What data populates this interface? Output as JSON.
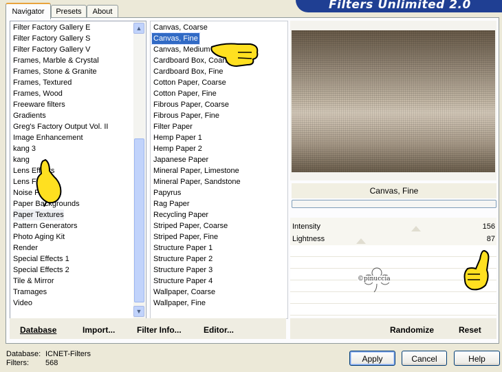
{
  "tabs": [
    {
      "label": "Navigator",
      "active": true
    },
    {
      "label": "Presets",
      "active": false
    },
    {
      "label": "About",
      "active": false
    }
  ],
  "banner": {
    "title": "Filters Unlimited 2.0"
  },
  "categories": [
    "Filter Factory Gallery E",
    "Filter Factory Gallery S",
    "Filter Factory Gallery V",
    "Frames, Marble & Crystal",
    "Frames, Stone & Granite",
    "Frames, Textured",
    "Frames, Wood",
    "Freeware filters",
    "Gradients",
    "Greg's Factory Output Vol. II",
    "Image Enhancement",
    "kang 3",
    "kang",
    "Lens Effects",
    "Lens Flares",
    "Noise Filters",
    "Paper Backgrounds",
    "Paper Textures",
    "Pattern Generators",
    "Photo Aging Kit",
    "Render",
    "Special Effects 1",
    "Special Effects 2",
    "Tile & Mirror",
    "Tramages",
    "Video"
  ],
  "selected_category": "Paper Textures",
  "filters": [
    "Canvas, Coarse",
    "Canvas, Fine",
    "Canvas, Medium",
    "Cardboard Box, Coarse",
    "Cardboard Box, Fine",
    "Cotton Paper, Coarse",
    "Cotton Paper, Fine",
    "Fibrous Paper, Coarse",
    "Fibrous Paper, Fine",
    "Filter Paper",
    "Hemp Paper 1",
    "Hemp Paper 2",
    "Japanese Paper",
    "Mineral Paper, Limestone",
    "Mineral Paper, Sandstone",
    "Papyrus",
    "Rag Paper",
    "Recycling Paper",
    "Striped Paper, Coarse",
    "Striped Paper, Fine",
    "Structure Paper 1",
    "Structure Paper 2",
    "Structure Paper 3",
    "Structure Paper 4",
    "Wallpaper, Coarse",
    "Wallpaper, Fine"
  ],
  "selected_filter": "Canvas, Fine",
  "left_buttons": {
    "database": "Database",
    "import": "Import...",
    "filter_info": "Filter Info...",
    "editor": "Editor..."
  },
  "preview": {
    "filter_name": "Canvas, Fine",
    "progress": 0
  },
  "params": [
    {
      "label": "Intensity",
      "value": "156"
    },
    {
      "label": "Lightness",
      "value": "87"
    }
  ],
  "watermark": "©pinuccia",
  "right_buttons": {
    "randomize": "Randomize",
    "reset": "Reset"
  },
  "footer": {
    "database_label": "Database:",
    "database_value": "ICNET-Filters",
    "filters_label": "Filters:",
    "filters_value": "568"
  },
  "dialog_buttons": {
    "apply": "Apply",
    "cancel": "Cancel",
    "help": "Help"
  },
  "colors": {
    "selection": "#316ac5",
    "banner": "#1f3f93",
    "window": "#ece9d8"
  }
}
